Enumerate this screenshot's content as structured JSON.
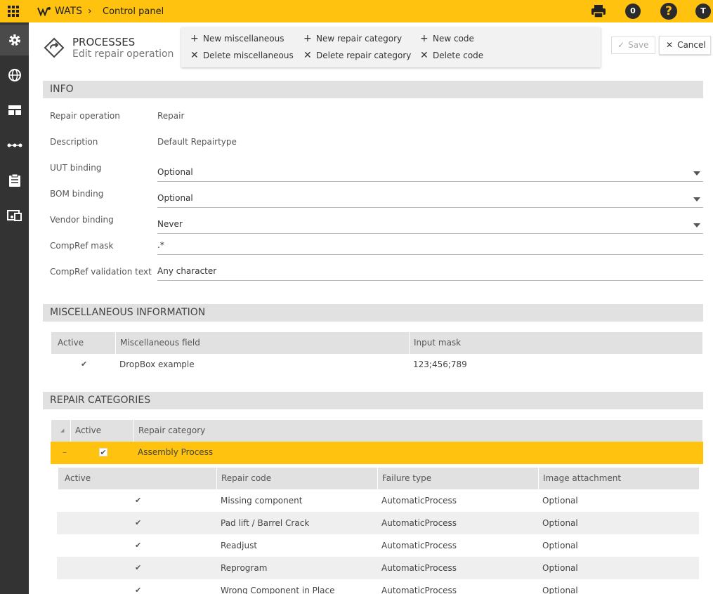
{
  "topbar": {
    "app_name": "WATS",
    "breadcrumb": "Control panel",
    "notifications_count": "0",
    "help_symbol": "?",
    "user_initial": "T"
  },
  "sidebar": {
    "items": [
      {
        "icon": "gear-icon"
      },
      {
        "icon": "globe-icon"
      },
      {
        "icon": "dashboard-icon"
      },
      {
        "icon": "process-flow-icon"
      },
      {
        "icon": "clipboard-icon"
      },
      {
        "icon": "devices-icon"
      }
    ]
  },
  "header": {
    "title": "PROCESSES",
    "subtitle": "Edit repair operation"
  },
  "toolbar": {
    "new_misc": "New miscellaneous",
    "delete_misc": "Delete miscellaneous",
    "new_repair_category": "New repair category",
    "delete_repair_category": "Delete repair category",
    "new_code": "New code",
    "delete_code": "Delete code",
    "save": "Save",
    "cancel": "Cancel"
  },
  "info": {
    "title": "INFO",
    "repair_operation_label": "Repair operation",
    "repair_operation_value": "Repair",
    "description_label": "Description",
    "description_value": "Default Repairtype",
    "uut_binding_label": "UUT binding",
    "uut_binding_value": "Optional",
    "bom_binding_label": "BOM binding",
    "bom_binding_value": "Optional",
    "vendor_binding_label": "Vendor binding",
    "vendor_binding_value": "Never",
    "compref_mask_label": "CompRef mask",
    "compref_mask_value": ".*",
    "compref_validation_label": "CompRef validation text",
    "compref_validation_value": "Any character"
  },
  "misc": {
    "title": "MISCELLANEOUS INFORMATION",
    "col_active": "Active",
    "col_field": "Miscellaneous field",
    "col_mask": "Input mask",
    "rows": [
      {
        "active": true,
        "field": "DropBox example",
        "mask": "123;456;789"
      }
    ]
  },
  "repair": {
    "title": "REPAIR CATEGORIES",
    "col_active": "Active",
    "col_category": "Repair category",
    "category": {
      "name": "Assembly Process",
      "active": true,
      "expand_symbol": "–"
    },
    "codes_header": {
      "active": "Active",
      "code": "Repair code",
      "failure": "Failure type",
      "image": "Image attachment"
    },
    "codes": [
      {
        "active": true,
        "code": "Missing component",
        "failure": "AutomaticProcess",
        "image": "Optional"
      },
      {
        "active": true,
        "code": "Pad lift / Barrel Crack",
        "failure": "AutomaticProcess",
        "image": "Optional"
      },
      {
        "active": true,
        "code": "Readjust",
        "failure": "AutomaticProcess",
        "image": "Optional"
      },
      {
        "active": true,
        "code": "Reprogram",
        "failure": "AutomaticProcess",
        "image": "Optional"
      },
      {
        "active": true,
        "code": "Wrong Component in Place",
        "failure": "AutomaticProcess",
        "image": "Optional"
      }
    ]
  },
  "colors": {
    "accent": "#ffc20e",
    "sidebar": "#333333",
    "section_header": "#e1e1e1"
  }
}
